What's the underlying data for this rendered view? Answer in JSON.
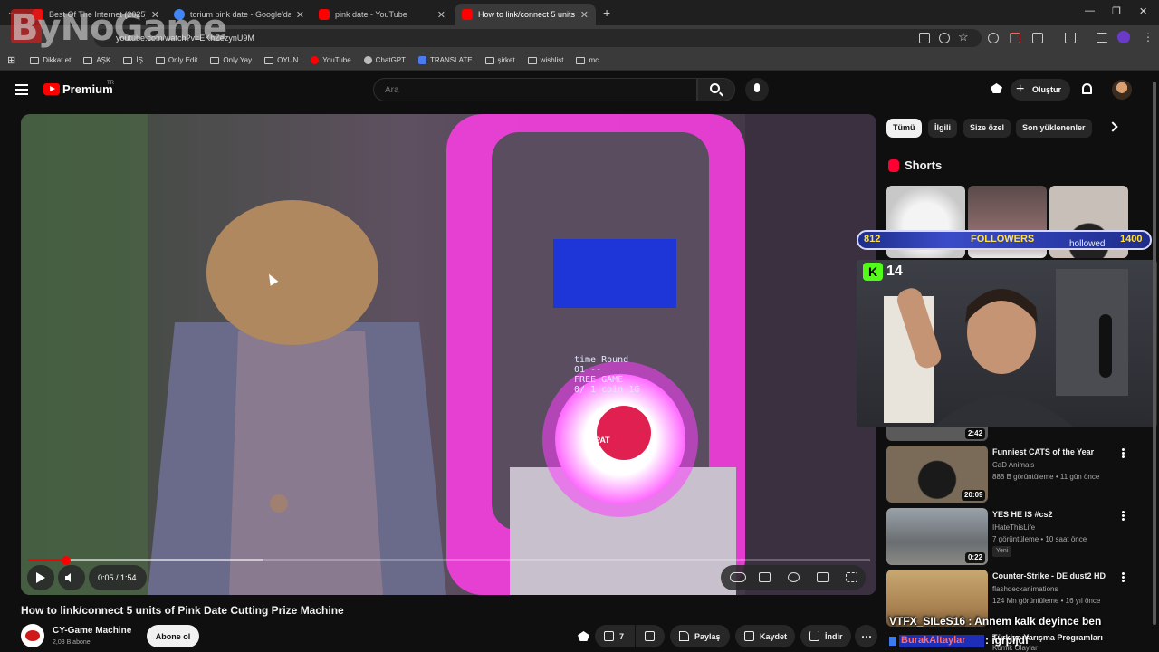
{
  "browser": {
    "tabs": [
      {
        "title": "Best Of The Internet (2025) - Yo",
        "favicon_color": "#ff0000",
        "active": false
      },
      {
        "title": "torium pink date - Google'da A",
        "favicon_color": "#4285f4",
        "active": false
      },
      {
        "title": "pink date - YouTube",
        "favicon_color": "#ff0000",
        "active": false
      },
      {
        "title": "How to link/connect 5 units of",
        "favicon_color": "#ff0000",
        "active": true
      }
    ],
    "new_tab": "+",
    "url": "youtube.com/watch?v=EKhZezynU9M",
    "bookmarks": [
      {
        "label": "Dikkat et",
        "icon": "folder-icon"
      },
      {
        "label": "AŞK",
        "icon": "folder-icon"
      },
      {
        "label": "İŞ",
        "icon": "folder-icon"
      },
      {
        "label": "Only Edit",
        "icon": "folder-icon"
      },
      {
        "label": "Only Yay",
        "icon": "folder-icon"
      },
      {
        "label": "OYUN",
        "icon": "folder-icon"
      },
      {
        "label": "YouTube",
        "icon": "youtube-icon"
      },
      {
        "label": "ChatGPT",
        "icon": "chatgpt-icon"
      },
      {
        "label": "TRANSLATE",
        "icon": "translate-icon"
      },
      {
        "label": "şirket",
        "icon": "folder-icon"
      },
      {
        "label": "wishlist",
        "icon": "folder-icon"
      },
      {
        "label": "mc",
        "icon": "folder-icon"
      }
    ],
    "window_controls": {
      "minimize": "—",
      "restore": "❐",
      "close": "✕"
    }
  },
  "watermark": {
    "text": "ByNoGame"
  },
  "youtube": {
    "logo_text": "Premium",
    "country": "TR",
    "search_placeholder": "Ara",
    "create_label": "Oluştur",
    "accent": "#ff0000"
  },
  "player": {
    "screen_line1": "time  Round",
    "screen_line2": "01     --",
    "screen_line3": "FREE GAME",
    "screen_line4": "0/ 1 coin 1G",
    "button_label": "PAT",
    "time": "0:05 / 1:54",
    "progress": 0.045,
    "buffered": 0.28
  },
  "video": {
    "title": "How to link/connect 5 units of Pink Date Cutting Prize Machine",
    "channel": "CY-Game Machine",
    "subscribers": "2,03 B abone",
    "subscribe_label": "Abone ol",
    "likes": "7",
    "share_label": "Paylaş",
    "save_label": "Kaydet",
    "download_label": "İndir"
  },
  "chips": [
    "Tümü",
    "İlgili",
    "Size özel",
    "Son yüklenenler"
  ],
  "shorts": {
    "title": "Shorts"
  },
  "overlay": {
    "followers_current": "812",
    "followers_label": "FOLLOWERS",
    "followers_name": "hollowed",
    "followers_goal": "1400",
    "kick_letter": "K",
    "kick_viewers": "14"
  },
  "related": [
    {
      "title": "",
      "channel": "",
      "meta": "",
      "duration": "2:42"
    },
    {
      "title": "Funniest CATS of the Year",
      "channel": "CaD Animals",
      "meta": "888 B görüntüleme • 11 gün önce",
      "duration": "20:09"
    },
    {
      "title": "YES HE IS #cs2",
      "channel": "IHateThisLife",
      "meta": "7 görüntüleme • 10 saat önce",
      "badge": "Yeni",
      "duration": "0:22"
    },
    {
      "title": "Counter-Strike - DE dust2 HD",
      "channel": "flashdeckanimations",
      "meta": "124 Mn görüntüleme • 16 yıl önce",
      "duration": ""
    },
    {
      "title": "Türkiye Yarışma Programları",
      "channel": "Komik Olaylar",
      "meta": "",
      "duration": ""
    }
  ],
  "subtitles": {
    "line1": "VTFX_SILeS16 : Annem kalk deyince ben",
    "line2_name": "BurakAltaylar",
    "line2": ": igrpijdf"
  }
}
